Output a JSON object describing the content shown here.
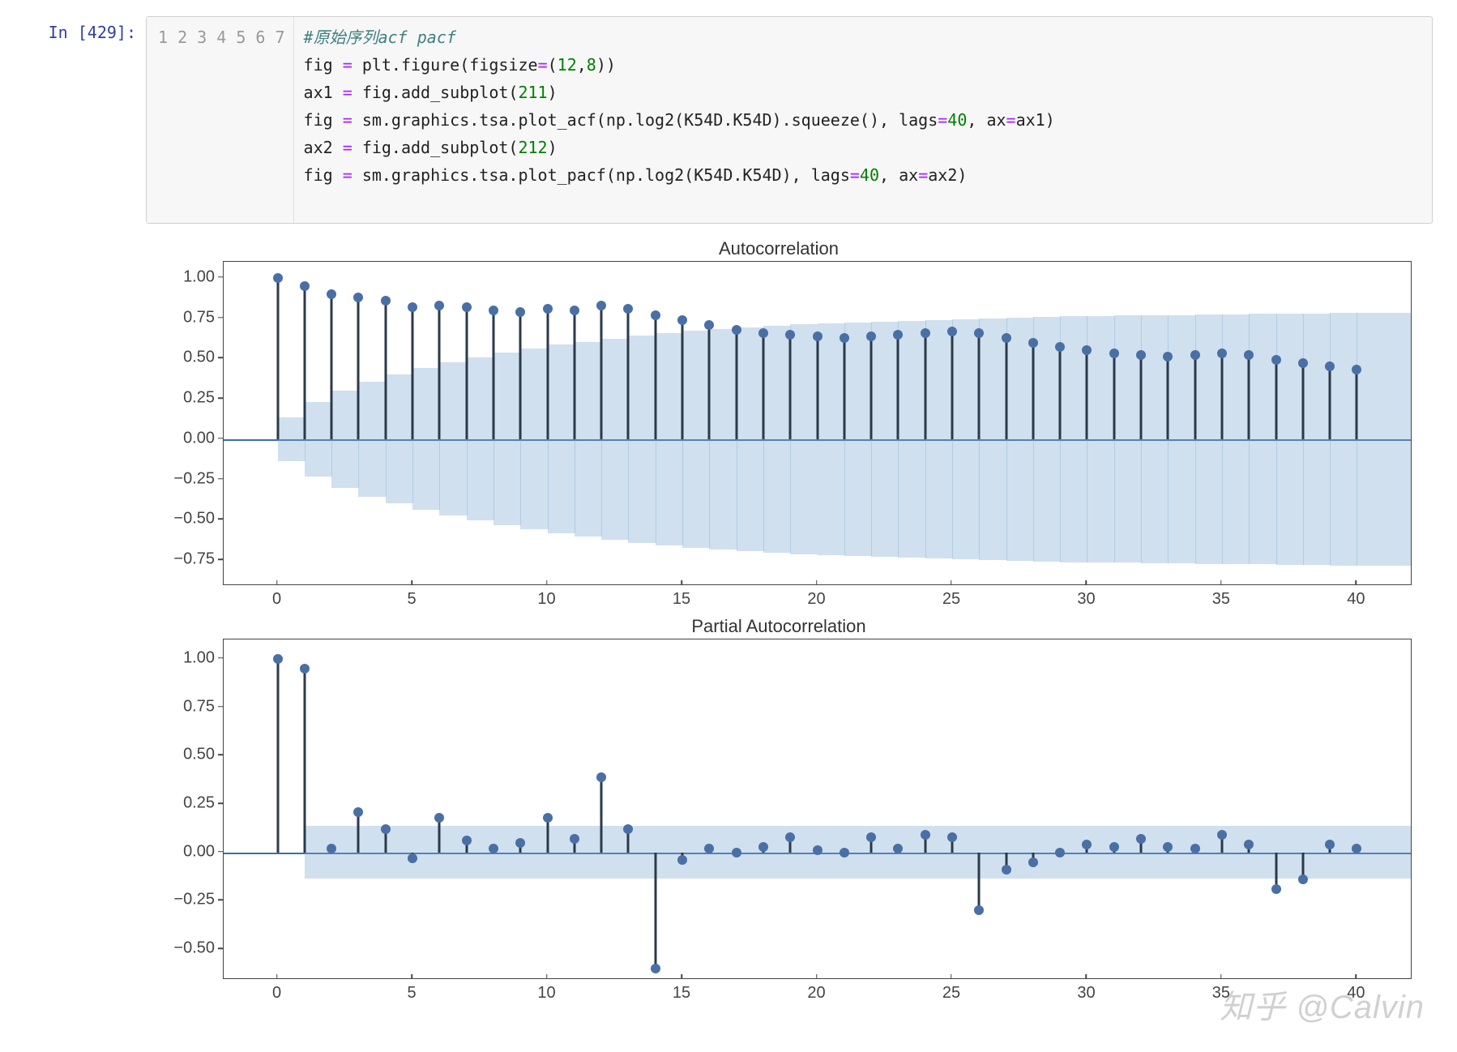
{
  "prompt": {
    "label": "In [429]:"
  },
  "code": {
    "gutter": [
      "1",
      "2",
      "3",
      "4",
      "5",
      "6",
      "7"
    ],
    "lines": [
      {
        "segs": [
          {
            "t": "#原始序列acf pacf",
            "c": "cm-comment"
          }
        ]
      },
      {
        "segs": [
          {
            "t": "fig "
          },
          {
            "t": "= ",
            "c": "cm-op"
          },
          {
            "t": "plt.figure(figsize"
          },
          {
            "t": "=",
            "c": "cm-op"
          },
          {
            "t": "("
          },
          {
            "t": "12",
            "c": "cm-number"
          },
          {
            "t": ","
          },
          {
            "t": "8",
            "c": "cm-number"
          },
          {
            "t": "))"
          }
        ]
      },
      {
        "segs": [
          {
            "t": "ax1 "
          },
          {
            "t": "= ",
            "c": "cm-op"
          },
          {
            "t": "fig.add_subplot("
          },
          {
            "t": "211",
            "c": "cm-number"
          },
          {
            "t": ")"
          }
        ]
      },
      {
        "segs": [
          {
            "t": "fig "
          },
          {
            "t": "= ",
            "c": "cm-op"
          },
          {
            "t": "sm.graphics.tsa.plot_acf(np.log2(K54D.K54D).squeeze(), lags"
          },
          {
            "t": "=",
            "c": "cm-op"
          },
          {
            "t": "40",
            "c": "cm-number"
          },
          {
            "t": ", ax"
          },
          {
            "t": "=",
            "c": "cm-op"
          },
          {
            "t": "ax1)"
          }
        ]
      },
      {
        "segs": [
          {
            "t": "ax2 "
          },
          {
            "t": "= ",
            "c": "cm-op"
          },
          {
            "t": "fig.add_subplot("
          },
          {
            "t": "212",
            "c": "cm-number"
          },
          {
            "t": ")"
          }
        ]
      },
      {
        "segs": [
          {
            "t": "fig "
          },
          {
            "t": "= ",
            "c": "cm-op"
          },
          {
            "t": "sm.graphics.tsa.plot_pacf(np.log2(K54D.K54D), lags"
          },
          {
            "t": "=",
            "c": "cm-op"
          },
          {
            "t": "40",
            "c": "cm-number"
          },
          {
            "t": ", ax"
          },
          {
            "t": "=",
            "c": "cm-op"
          },
          {
            "t": "ax2)"
          }
        ]
      },
      {
        "segs": [
          {
            "t": " "
          }
        ]
      }
    ]
  },
  "watermark": "知乎 @Calvin",
  "chart_data": [
    {
      "type": "bar",
      "title": "Autocorrelation",
      "xlabel": "",
      "ylabel": "",
      "xlim": [
        -2,
        42
      ],
      "ylim": [
        -0.9,
        1.1
      ],
      "xticks": [
        0,
        5,
        10,
        15,
        20,
        25,
        30,
        35,
        40
      ],
      "yticks": [
        -0.75,
        -0.5,
        -0.25,
        0.0,
        0.25,
        0.5,
        0.75,
        1.0
      ],
      "x": [
        0,
        1,
        2,
        3,
        4,
        5,
        6,
        7,
        8,
        9,
        10,
        11,
        12,
        13,
        14,
        15,
        16,
        17,
        18,
        19,
        20,
        21,
        22,
        23,
        24,
        25,
        26,
        27,
        28,
        29,
        30,
        31,
        32,
        33,
        34,
        35,
        36,
        37,
        38,
        39,
        40
      ],
      "values": [
        1.0,
        0.95,
        0.9,
        0.88,
        0.86,
        0.82,
        0.83,
        0.82,
        0.8,
        0.79,
        0.81,
        0.8,
        0.83,
        0.81,
        0.77,
        0.74,
        0.71,
        0.68,
        0.66,
        0.65,
        0.64,
        0.63,
        0.64,
        0.65,
        0.66,
        0.67,
        0.66,
        0.63,
        0.6,
        0.57,
        0.55,
        0.53,
        0.52,
        0.51,
        0.52,
        0.53,
        0.52,
        0.49,
        0.47,
        0.45,
        0.43
      ],
      "ci_upper": [
        0.0,
        0.135,
        0.23,
        0.3,
        0.355,
        0.4,
        0.44,
        0.475,
        0.505,
        0.535,
        0.56,
        0.585,
        0.605,
        0.625,
        0.645,
        0.66,
        0.675,
        0.685,
        0.695,
        0.705,
        0.715,
        0.72,
        0.725,
        0.73,
        0.735,
        0.74,
        0.745,
        0.75,
        0.755,
        0.76,
        0.762,
        0.764,
        0.766,
        0.768,
        0.77,
        0.772,
        0.774,
        0.776,
        0.778,
        0.78,
        0.782
      ]
    },
    {
      "type": "bar",
      "title": "Partial Autocorrelation",
      "xlabel": "",
      "ylabel": "",
      "xlim": [
        -2,
        42
      ],
      "ylim": [
        -0.65,
        1.1
      ],
      "xticks": [
        0,
        5,
        10,
        15,
        20,
        25,
        30,
        35,
        40
      ],
      "yticks": [
        -0.5,
        -0.25,
        0.0,
        0.25,
        0.5,
        0.75,
        1.0
      ],
      "ci": 0.135,
      "x": [
        0,
        1,
        2,
        3,
        4,
        5,
        6,
        7,
        8,
        9,
        10,
        11,
        12,
        13,
        14,
        15,
        16,
        17,
        18,
        19,
        20,
        21,
        22,
        23,
        24,
        25,
        26,
        27,
        28,
        29,
        30,
        31,
        32,
        33,
        34,
        35,
        36,
        37,
        38,
        39,
        40
      ],
      "values": [
        1.0,
        0.95,
        0.02,
        0.21,
        0.12,
        -0.03,
        0.18,
        0.06,
        0.02,
        0.05,
        0.18,
        0.07,
        0.39,
        0.12,
        -0.6,
        -0.04,
        0.02,
        0.0,
        0.03,
        0.08,
        0.01,
        0.0,
        0.08,
        0.02,
        0.09,
        0.08,
        -0.3,
        -0.09,
        -0.05,
        0.0,
        0.04,
        0.03,
        0.07,
        0.03,
        0.02,
        0.09,
        0.04,
        -0.19,
        -0.14,
        0.04,
        0.02
      ]
    }
  ]
}
